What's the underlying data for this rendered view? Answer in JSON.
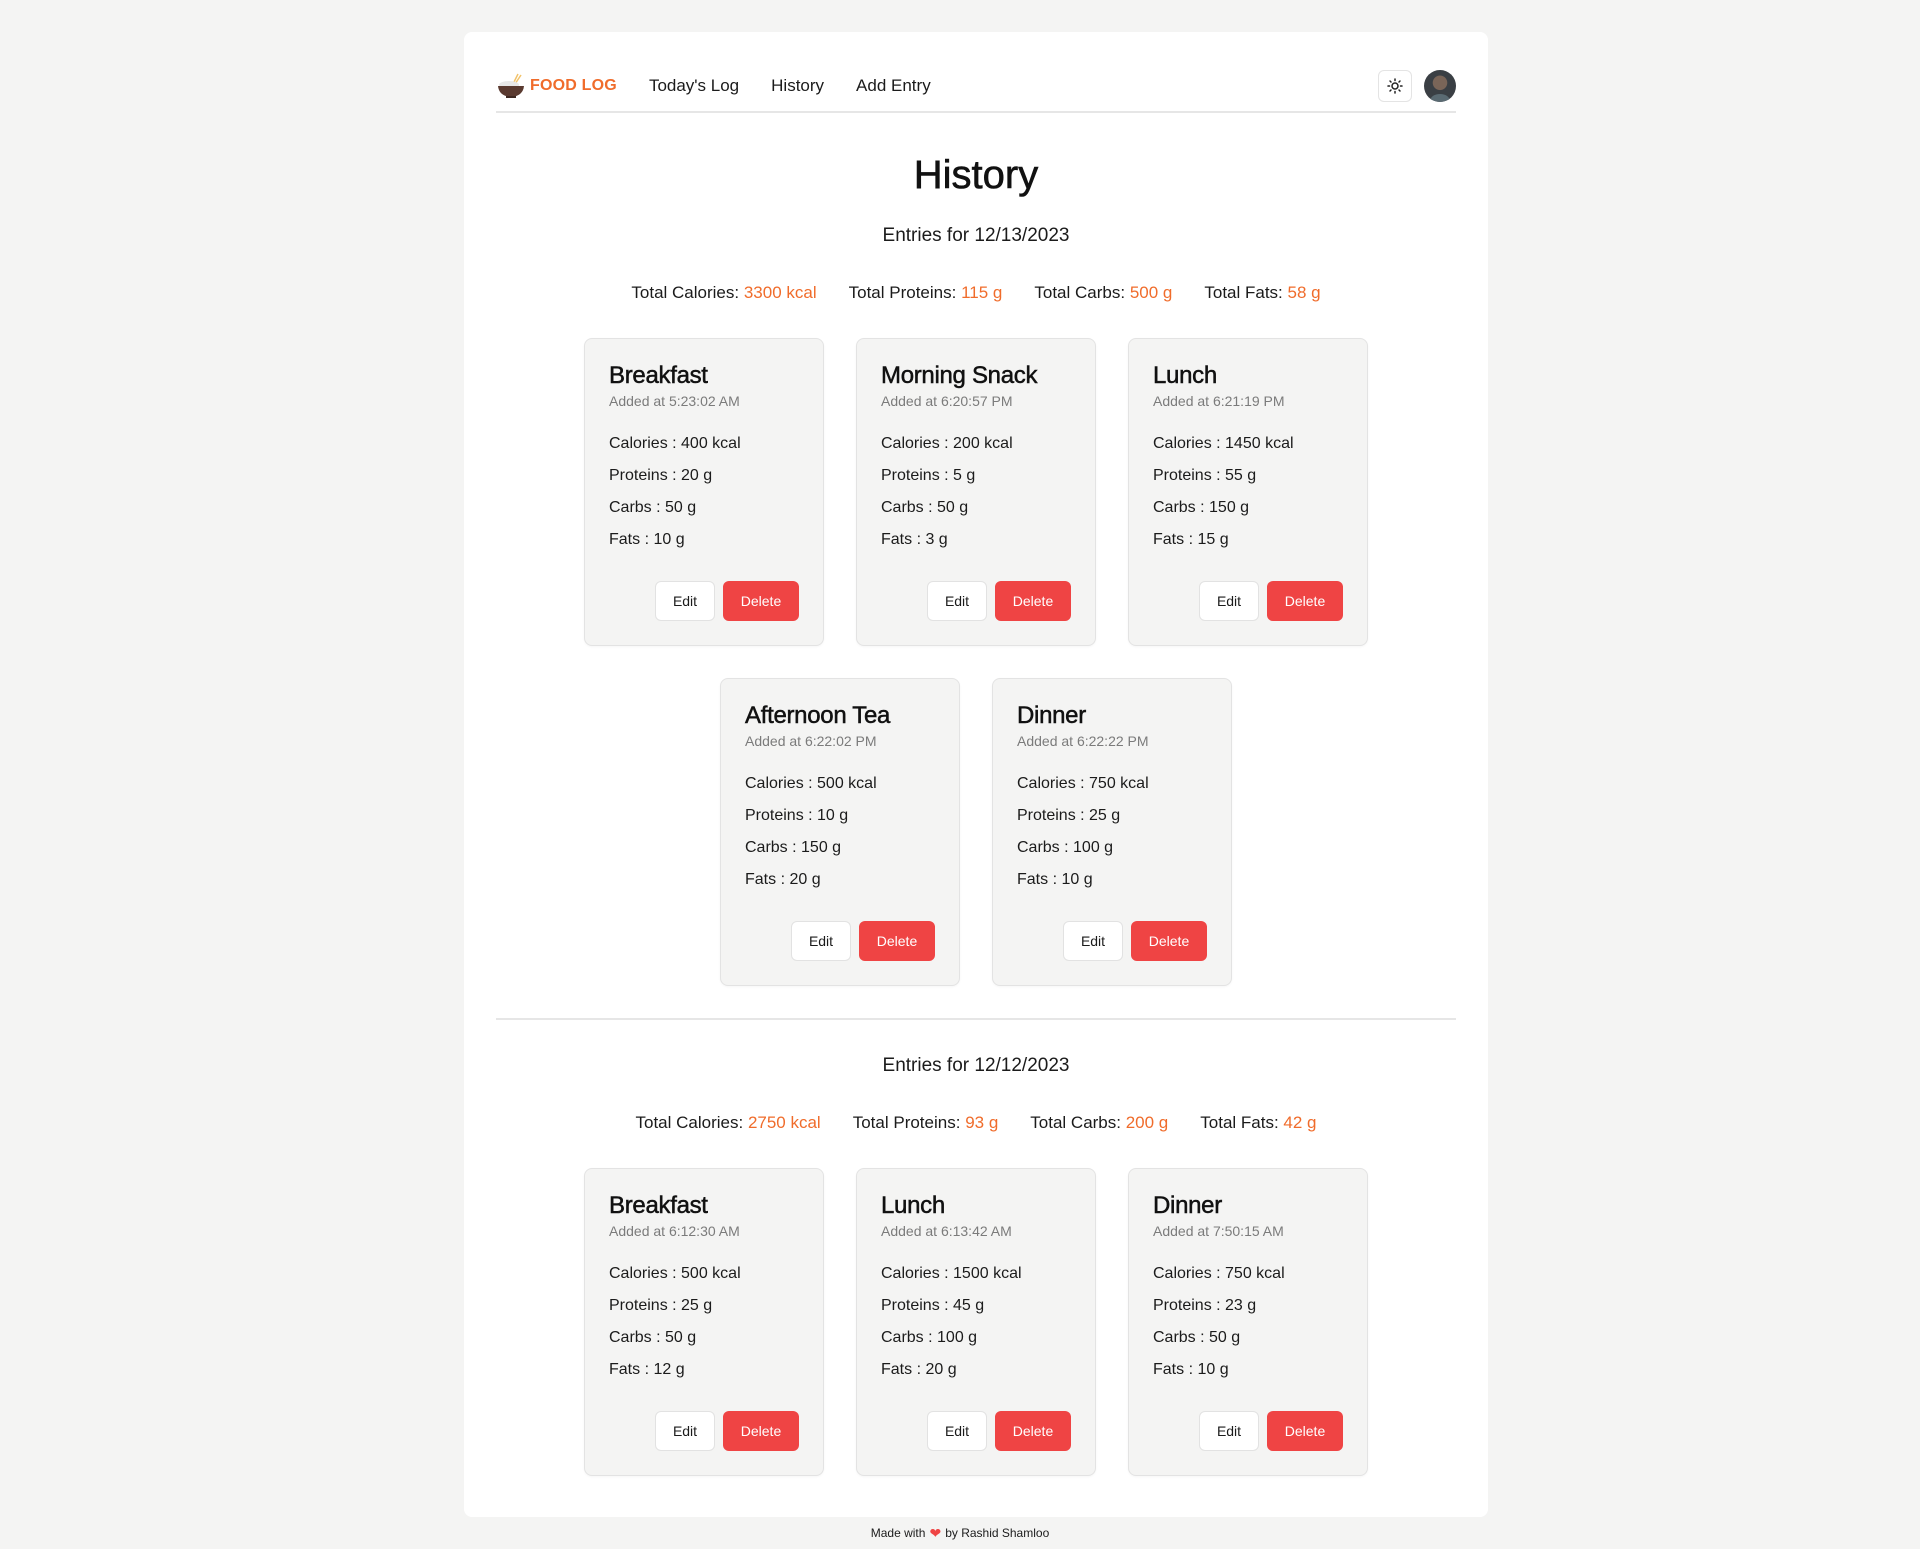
{
  "nav": {
    "brand": "FOOD LOG",
    "links": [
      "Today's Log",
      "History",
      "Add Entry"
    ],
    "theme_icon": "sun-icon",
    "avatar_icon": "user-avatar"
  },
  "page_title": "History",
  "accent_color": "#f06c2b",
  "danger_color": "#ef4444",
  "sections": [
    {
      "date_label": "Entries for 12/13/2023",
      "totals": {
        "calories_label": "Total Calories:",
        "calories": "3300 kcal",
        "proteins_label": "Total Proteins:",
        "proteins": "115 g",
        "carbs_label": "Total Carbs:",
        "carbs": "500 g",
        "fats_label": "Total Fats:",
        "fats": "58 g"
      },
      "entries": [
        {
          "title": "Breakfast",
          "time": "Added at 5:23:02 AM",
          "calories": "Calories : 400 kcal",
          "proteins": "Proteins : 20 g",
          "carbs": "Carbs : 50 g",
          "fats": "Fats : 10 g"
        },
        {
          "title": "Morning Snack",
          "time": "Added at 6:20:57 PM",
          "calories": "Calories : 200 kcal",
          "proteins": "Proteins : 5 g",
          "carbs": "Carbs : 50 g",
          "fats": "Fats : 3 g"
        },
        {
          "title": "Lunch",
          "time": "Added at 6:21:19 PM",
          "calories": "Calories : 1450 kcal",
          "proteins": "Proteins : 55 g",
          "carbs": "Carbs : 150 g",
          "fats": "Fats : 15 g"
        },
        {
          "title": "Afternoon Tea",
          "time": "Added at 6:22:02 PM",
          "calories": "Calories : 500 kcal",
          "proteins": "Proteins : 10 g",
          "carbs": "Carbs : 150 g",
          "fats": "Fats : 20 g"
        },
        {
          "title": "Dinner",
          "time": "Added at 6:22:22 PM",
          "calories": "Calories : 750 kcal",
          "proteins": "Proteins : 25 g",
          "carbs": "Carbs : 100 g",
          "fats": "Fats : 10 g"
        }
      ]
    },
    {
      "date_label": "Entries for 12/12/2023",
      "totals": {
        "calories_label": "Total Calories:",
        "calories": "2750 kcal",
        "proteins_label": "Total Proteins:",
        "proteins": "93 g",
        "carbs_label": "Total Carbs:",
        "carbs": "200 g",
        "fats_label": "Total Fats:",
        "fats": "42 g"
      },
      "entries": [
        {
          "title": "Breakfast",
          "time": "Added at 6:12:30 AM",
          "calories": "Calories : 500 kcal",
          "proteins": "Proteins : 25 g",
          "carbs": "Carbs : 50 g",
          "fats": "Fats : 12 g"
        },
        {
          "title": "Lunch",
          "time": "Added at 6:13:42 AM",
          "calories": "Calories : 1500 kcal",
          "proteins": "Proteins : 45 g",
          "carbs": "Carbs : 100 g",
          "fats": "Fats : 20 g"
        },
        {
          "title": "Dinner",
          "time": "Added at 7:50:15 AM",
          "calories": "Calories : 750 kcal",
          "proteins": "Proteins : 23 g",
          "carbs": "Carbs : 50 g",
          "fats": "Fats : 10 g"
        }
      ]
    }
  ],
  "buttons": {
    "edit": "Edit",
    "delete": "Delete"
  },
  "footer": {
    "prefix": "Made with",
    "heart": "❤",
    "suffix": "by Rashid Shamloo"
  }
}
